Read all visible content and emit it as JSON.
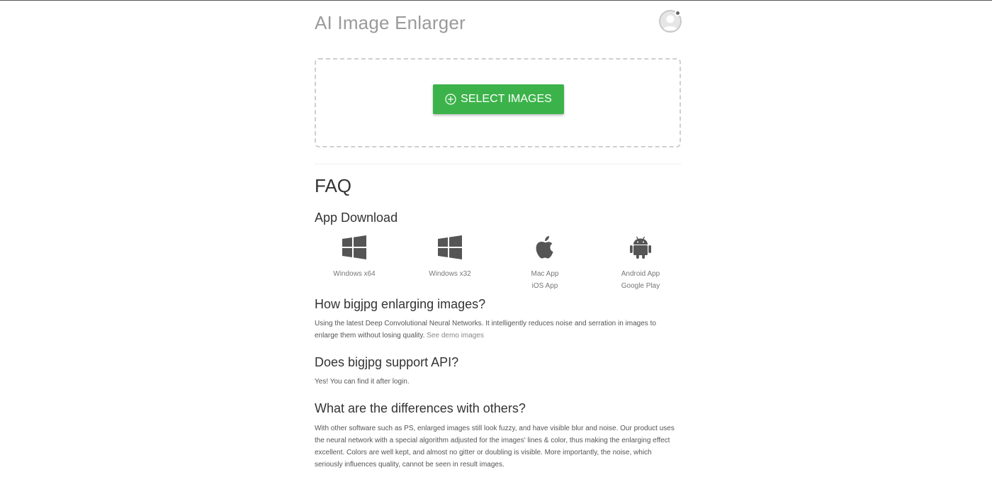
{
  "header": {
    "title": "AI Image Enlarger",
    "avatar_icon": "user-avatar-icon"
  },
  "upload": {
    "select_button_label": "SELECT IMAGES",
    "select_button_icon": "plus-circle-icon",
    "accent_color": "#3cb34a"
  },
  "faq": {
    "title": "FAQ",
    "app_download_title": "App Download",
    "apps": [
      {
        "icon": "windows-icon",
        "labels": [
          "Windows x64"
        ]
      },
      {
        "icon": "windows-icon",
        "labels": [
          "Windows x32"
        ]
      },
      {
        "icon": "apple-icon",
        "labels": [
          "Mac App",
          "iOS App"
        ]
      },
      {
        "icon": "android-icon",
        "labels": [
          "Android App",
          "Google Play"
        ]
      }
    ],
    "q1": {
      "question": "How bigjpg enlarging images?",
      "answer": "Using the latest Deep Convolutional Neural Networks. It intelligently reduces noise and serration in images to enlarge them without losing quality.",
      "link": "See demo images"
    },
    "q2": {
      "question": "Does bigjpg support API?",
      "answer": "Yes! You can find it after login."
    },
    "q3": {
      "question": "What are the differences with others?",
      "answer": "With other software such as PS, enlarged images still look fuzzy, and have visible blur and noise. Our product uses the neural network with a special algorithm adjusted for the images' lines & color, thus making the enlarging effect excellent. Colors are well kept, and almost no gitter or doubling is visible. More importantly, the noise, which seriously influences quality, cannot be seen in result images."
    }
  }
}
